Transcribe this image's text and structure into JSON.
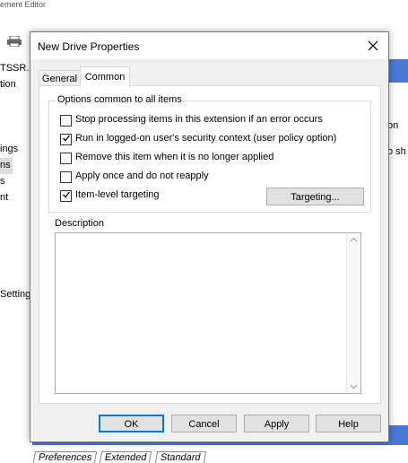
{
  "background": {
    "title_fragment": "ement Editor",
    "left_labels": [
      "TSSR.LA",
      "tion",
      "ings",
      "ns",
      "s",
      "nt",
      "Setting"
    ],
    "right_labels": [
      "on",
      "o sh"
    ],
    "bottom_tabs": [
      "Preferences",
      "Extended",
      "Standard"
    ]
  },
  "dialog": {
    "title": "New Drive Properties",
    "close_icon": "close-icon",
    "tabs": [
      {
        "label": "General",
        "active": false
      },
      {
        "label": "Common",
        "active": true
      }
    ],
    "group_title": "Options common to all items",
    "options": [
      {
        "label": "Stop processing items in this extension if an error occurs",
        "checked": false
      },
      {
        "label": "Run in logged-on user's security context (user policy option)",
        "checked": true
      },
      {
        "label": "Remove this item when it is no longer applied",
        "checked": false
      },
      {
        "label": "Apply once and do not reapply",
        "checked": false
      },
      {
        "label": "Item-level targeting",
        "checked": true
      }
    ],
    "targeting_button": "Targeting...",
    "description_label": "Description",
    "description_value": "",
    "buttons": {
      "ok": "OK",
      "cancel": "Cancel",
      "apply": "Apply",
      "help": "Help"
    }
  },
  "colors": {
    "selection_blue": "#4a78d6",
    "default_button_border": "#0078d7"
  }
}
